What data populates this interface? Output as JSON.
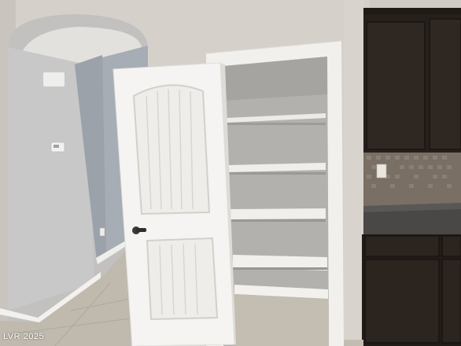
{
  "watermark": {
    "text": "LVR 2025",
    "color": "#ffffff"
  },
  "scene": {
    "colors": {
      "wall": "#d6d2cb",
      "wall_shadow": "#b9b5af",
      "hall_wall": "#a9b0b6",
      "trim": "#f3f2ef",
      "door": "#f4f3f1",
      "pantry_back": "#b4b2ae",
      "shelf": "#f1f0ec",
      "floor": "#c4beb4",
      "cabinet": "#2a211c",
      "backsplash": "#7c7066",
      "countertop": "#4d4b49"
    },
    "icons": [
      "door-knob-icon",
      "thermostat-icon",
      "outlet-icon"
    ]
  }
}
